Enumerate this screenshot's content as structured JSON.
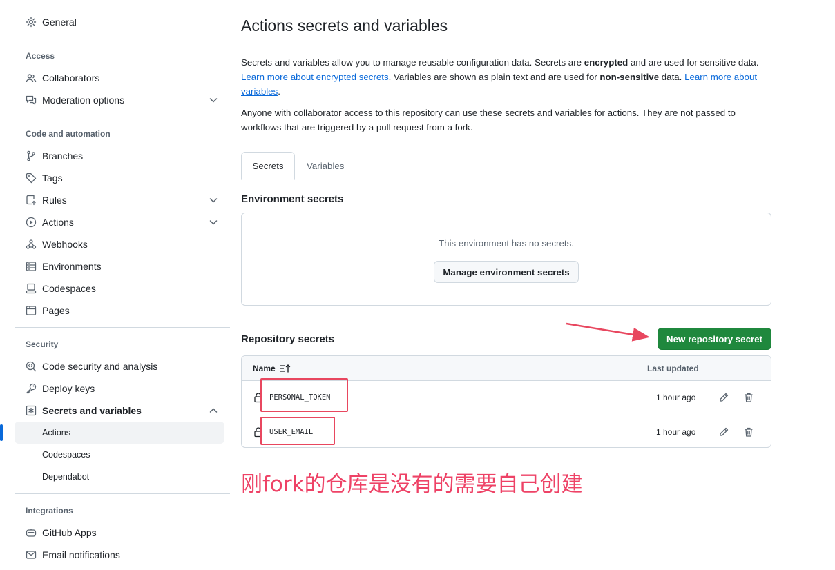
{
  "sidebar": {
    "general": "General",
    "access_label": "Access",
    "collaborators": "Collaborators",
    "moderation": "Moderation options",
    "code_automation_label": "Code and automation",
    "branches": "Branches",
    "tags": "Tags",
    "rules": "Rules",
    "actions": "Actions",
    "webhooks": "Webhooks",
    "environments": "Environments",
    "codespaces": "Codespaces",
    "pages": "Pages",
    "security_label": "Security",
    "code_security": "Code security and analysis",
    "deploy_keys": "Deploy keys",
    "secrets_vars": "Secrets and variables",
    "sub_actions": "Actions",
    "sub_codespaces": "Codespaces",
    "sub_dependabot": "Dependabot",
    "integrations_label": "Integrations",
    "github_apps": "GitHub Apps",
    "email_notifications": "Email notifications"
  },
  "main": {
    "title": "Actions secrets and variables",
    "intro": {
      "p1_a": "Secrets and variables allow you to manage reusable configuration data. Secrets are ",
      "p1_b": "encrypted",
      "p1_c": " and are used for sensitive data. ",
      "p1_link1": "Learn more about encrypted secrets",
      "p1_d": ". Variables are shown as plain text and are used for ",
      "p1_e": "non-sensitive",
      "p1_f": " data. ",
      "p1_link2": "Learn more about variables",
      "p1_g": ".",
      "p2": "Anyone with collaborator access to this repository can use these secrets and variables for actions. They are not passed to workflows that are triggered by a pull request from a fork."
    },
    "tabs": [
      "Secrets",
      "Variables"
    ],
    "env_heading": "Environment secrets",
    "env_empty": "This environment has no secrets.",
    "env_button": "Manage environment secrets",
    "repo_heading": "Repository secrets",
    "new_secret_button": "New repository secret",
    "table": {
      "col_name": "Name",
      "col_updated": "Last updated",
      "rows": [
        {
          "name": "PERSONAL_TOKEN",
          "updated": "1 hour ago"
        },
        {
          "name": "USER_EMAIL",
          "updated": "1 hour ago"
        }
      ]
    }
  },
  "annotation": {
    "text": "刚fork的仓库是没有的需要自己创建",
    "color": "#ee4266"
  },
  "colors": {
    "primary_button": "#1f883d",
    "link": "#0969da",
    "active_indicator": "#0969da"
  }
}
